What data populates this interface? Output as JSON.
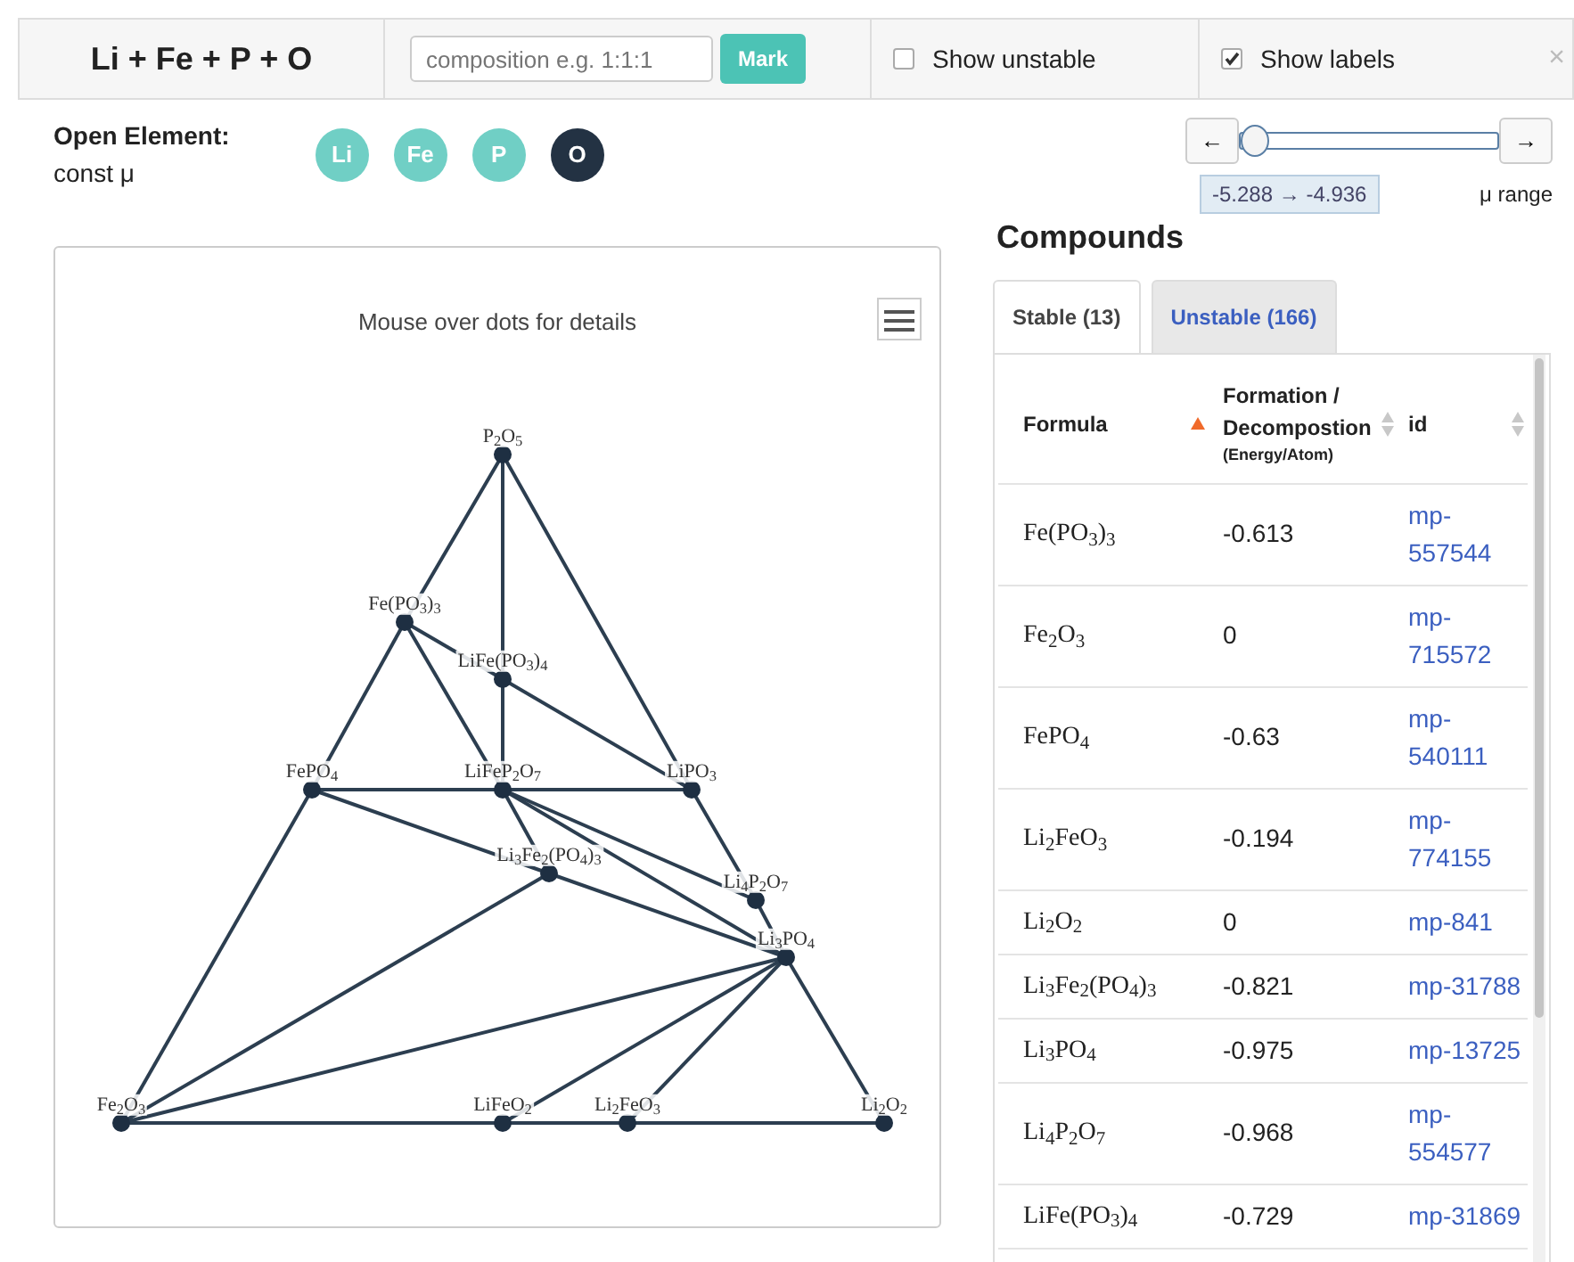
{
  "toolbar": {
    "title": "Li + Fe + P + O",
    "composition": {
      "placeholder": "composition e.g. 1:1:1"
    },
    "mark_button": "Mark",
    "toggles": [
      {
        "label": "Show unstable",
        "checked": false
      },
      {
        "label": "Show labels",
        "checked": true
      }
    ],
    "close": "×"
  },
  "open_element": {
    "label": "Open Element:",
    "sublabel": "const μ",
    "elements": [
      {
        "symbol": "Li",
        "selected": false
      },
      {
        "symbol": "Fe",
        "selected": false
      },
      {
        "symbol": "P",
        "selected": false
      },
      {
        "symbol": "O",
        "selected": true
      }
    ]
  },
  "mu_slider": {
    "left": "←",
    "right": "→",
    "level": 0.0,
    "range": "-5.288 → -4.936",
    "label": "μ range"
  },
  "diagram": {
    "title": "Mouse over dots for details",
    "nodes": [
      {
        "label": "P$_{2}$O$_{5}$"
      },
      {
        "label": "Fe(PO$_{3}$)$_{3}$"
      },
      {
        "label": "LiFe(PO$_{3}$)$_{4}$"
      },
      {
        "label": "FePO$_{4}$"
      },
      {
        "label": "LiFeP$_{2}$O$_{7}$"
      },
      {
        "label": "LiPO$_{3}$"
      },
      {
        "label": "Li$_{3}$Fe$_{2}$(PO$_{4}$)$_{3}$"
      },
      {
        "label": "Li$_{4}$P$_{2}$O$_{7}$"
      },
      {
        "label": "Li$_{3}$PO$_{4}$"
      },
      {
        "label": "Fe$_{2}$O$_{3}$"
      },
      {
        "label": "LiFeO$_{2}$"
      },
      {
        "label": "Li$_{2}$FeO$_{3}$"
      },
      {
        "label": "Li$_{2}$O$_{2}$"
      }
    ]
  },
  "compounds": {
    "title": "Compounds",
    "tabs": [
      {
        "label": "Stable (13)",
        "selected": true
      },
      {
        "label": "Unstable (166)",
        "selected": false
      }
    ],
    "columns": [
      {
        "label": "Formula",
        "sorted": true
      },
      {
        "label": "Formation / Decompostion",
        "sublabel": "(Energy/Atom)",
        "sorted": false
      },
      {
        "label": "id",
        "sorted": false
      }
    ],
    "rows": [
      {
        "formula": "Fe(PO$_{3}$)$_{3}$",
        "energy": "-0.613",
        "id": "mp-557544"
      },
      {
        "formula": "Fe$_{2}$O$_{3}$",
        "energy": "0",
        "id": "mp-715572"
      },
      {
        "formula": "FePO$_{4}$",
        "energy": "-0.63",
        "id": "mp-540111"
      },
      {
        "formula": "Li$_{2}$FeO$_{3}$",
        "energy": "-0.194",
        "id": "mp-774155"
      },
      {
        "formula": "Li$_{2}$O$_{2}$",
        "energy": "0",
        "id": "mp-841"
      },
      {
        "formula": "Li$_{3}$Fe$_{2}$(PO$_{4}$)$_{3}$",
        "energy": "-0.821",
        "id": "mp-31788"
      },
      {
        "formula": "Li$_{3}$PO$_{4}$",
        "energy": "-0.975",
        "id": "mp-13725"
      },
      {
        "formula": "Li$_{4}$P$_{2}$O$_{7}$",
        "energy": "-0.968",
        "id": "mp-554577"
      },
      {
        "formula": "LiFe(PO$_{3}$)$_{4}$",
        "energy": "-0.729",
        "id": "mp-31869"
      }
    ]
  }
}
